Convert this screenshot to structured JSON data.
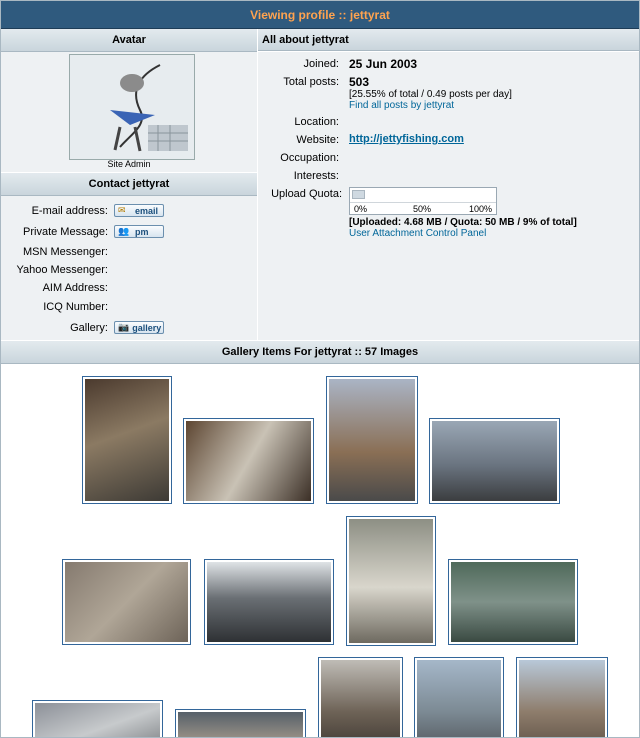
{
  "title": "Viewing profile :: jettyrat",
  "avatar": {
    "heading": "Avatar",
    "rank": "Site Admin"
  },
  "about": {
    "heading": "All about jettyrat",
    "joined_label": "Joined:",
    "joined_value": "25 Jun 2003",
    "total_posts_label": "Total posts:",
    "total_posts_value": "503",
    "posts_stats": "[25.55% of total / 0.49 posts per day]",
    "find_posts": "Find all posts by jettyrat",
    "location_label": "Location:",
    "website_label": "Website:",
    "website_value": "http://jettyfishing.com",
    "occupation_label": "Occupation:",
    "interests_label": "Interests:",
    "quota_label": "Upload Quota:",
    "quota_fill": 0.09,
    "quota_ticks": [
      "0%",
      "50%",
      "100%"
    ],
    "quota_text": "[Uploaded: 4.68 MB / Quota: 50 MB / 9% of total]",
    "attach_panel": "User Attachment Control Panel"
  },
  "contact": {
    "heading": "Contact jettyrat",
    "email_label": "E-mail address:",
    "email_btn": "email",
    "pm_label": "Private Message:",
    "pm_btn": "pm",
    "msn_label": "MSN Messenger:",
    "yahoo_label": "Yahoo Messenger:",
    "aim_label": "AIM Address:",
    "icq_label": "ICQ Number:",
    "gallery_label": "Gallery:",
    "gallery_btn": "gallery"
  },
  "gallery": {
    "heading": "Gallery Items For jettyrat :: 57 Images"
  },
  "colors": {
    "title_bg": "#2f5a7e",
    "title_text": "#ffa34f",
    "link": "#006699",
    "panel_bg": "#eef1f3"
  }
}
